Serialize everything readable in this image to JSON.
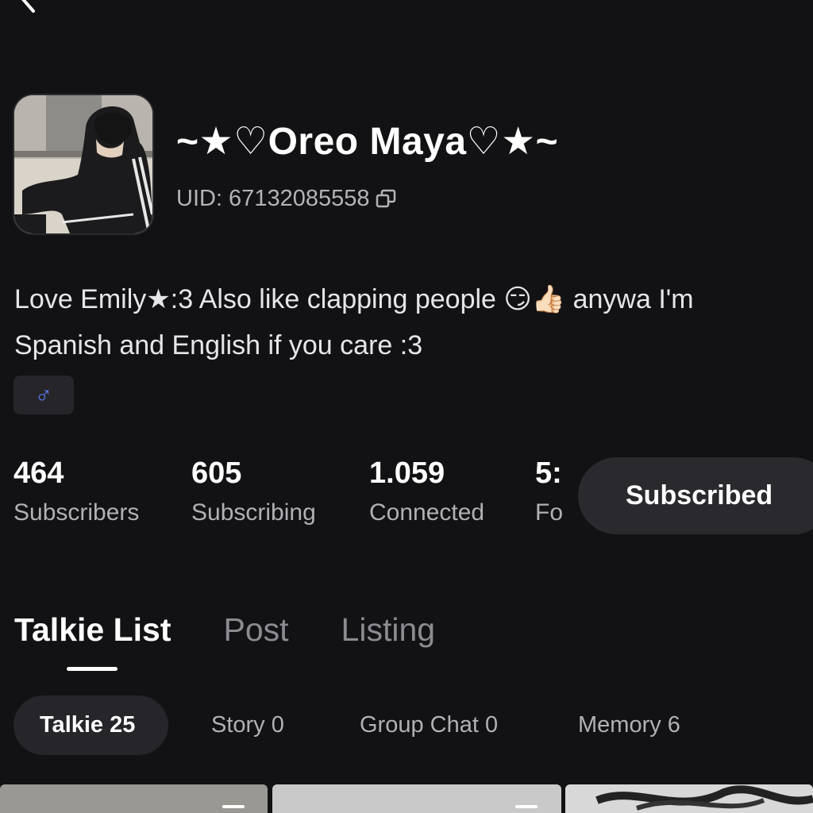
{
  "header": {
    "back_icon": "chevron-left-icon"
  },
  "profile": {
    "display_name": "~★♡Oreo Maya♡★~",
    "uid": "UID: 67132085558",
    "copy_icon": "copy-icon",
    "bio_line1": "Love Emily★:3 Also like clapping people 😏👍🏻 anywa I'm",
    "bio_line2": "Spanish and English if you care :3",
    "gender_badge": "♂"
  },
  "stats": [
    {
      "value": "464",
      "label": "Subscribers"
    },
    {
      "value": "605",
      "label": "Subscribing"
    },
    {
      "value": "1.059",
      "label": "Connected"
    },
    {
      "value": "5:",
      "label": "Fo"
    }
  ],
  "subscribe_button": {
    "label": "Subscribed"
  },
  "tabs": [
    {
      "label": "Talkie List",
      "active": true
    },
    {
      "label": "Post",
      "active": false
    },
    {
      "label": "Listing",
      "active": false
    }
  ],
  "filters": [
    {
      "label": "Talkie 25",
      "active": true
    },
    {
      "label": "Story 0",
      "active": false
    },
    {
      "label": "Group Chat 0",
      "active": false
    },
    {
      "label": "Memory 6",
      "active": false
    }
  ],
  "colors": {
    "background": "#121214",
    "chip_bg": "#25252a",
    "button_bg": "#2a2a2e",
    "gender_accent": "#5c7cf0",
    "muted_text": "#b0b0b6"
  }
}
